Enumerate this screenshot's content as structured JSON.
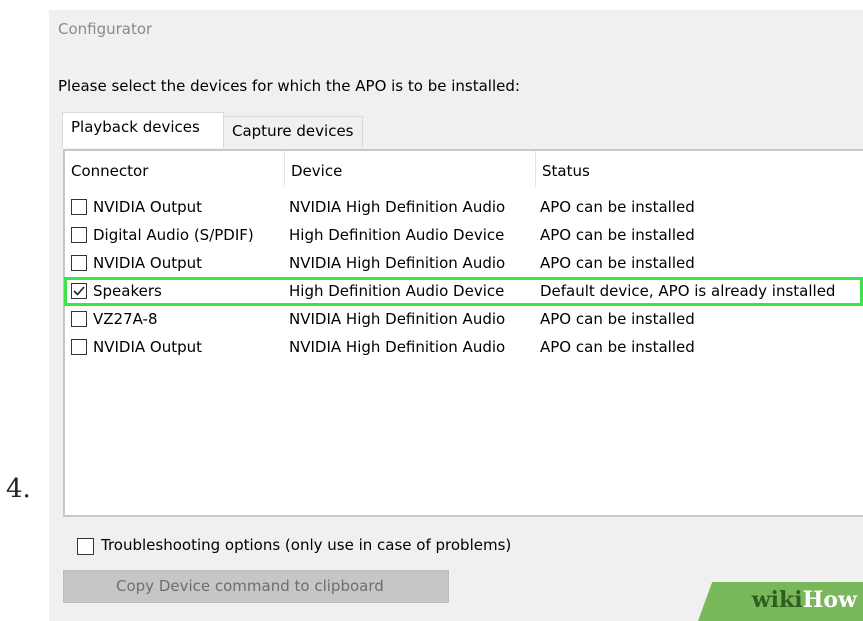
{
  "step_number": "4.",
  "window": {
    "title": "Configurator",
    "instruction": "Please select the devices for which the APO is to be installed:"
  },
  "tabs": [
    {
      "label": "Playback devices",
      "active": true
    },
    {
      "label": "Capture devices",
      "active": false
    }
  ],
  "table": {
    "columns": [
      "Connector",
      "Device",
      "Status"
    ],
    "rows": [
      {
        "connector": "NVIDIA Output",
        "device": "NVIDIA High Definition Audio",
        "status": "APO can be installed",
        "checked": false
      },
      {
        "connector": "Digital Audio (S/PDIF)",
        "device": "High Definition Audio Device",
        "status": "APO can be installed",
        "checked": false
      },
      {
        "connector": "NVIDIA Output",
        "device": "NVIDIA High Definition Audio",
        "status": "APO can be installed",
        "checked": false
      },
      {
        "connector": "Speakers",
        "device": "High Definition Audio Device",
        "status": "Default device, APO is already installed",
        "checked": true
      },
      {
        "connector": "VZ27A-8",
        "device": "NVIDIA High Definition Audio",
        "status": "APO can be installed",
        "checked": false
      },
      {
        "connector": "NVIDIA Output",
        "device": "NVIDIA High Definition Audio",
        "status": "APO can be installed",
        "checked": false
      }
    ]
  },
  "troubleshooting": {
    "label": "Troubleshooting options (only use in case of problems)",
    "checked": false
  },
  "copy_button": {
    "label": "Copy Device command to clipboard",
    "enabled": false
  },
  "watermark": {
    "part1": "wiki",
    "part2": "How"
  },
  "colors": {
    "highlight": "#3ee34a",
    "watermark_bg": "#78b85a"
  }
}
